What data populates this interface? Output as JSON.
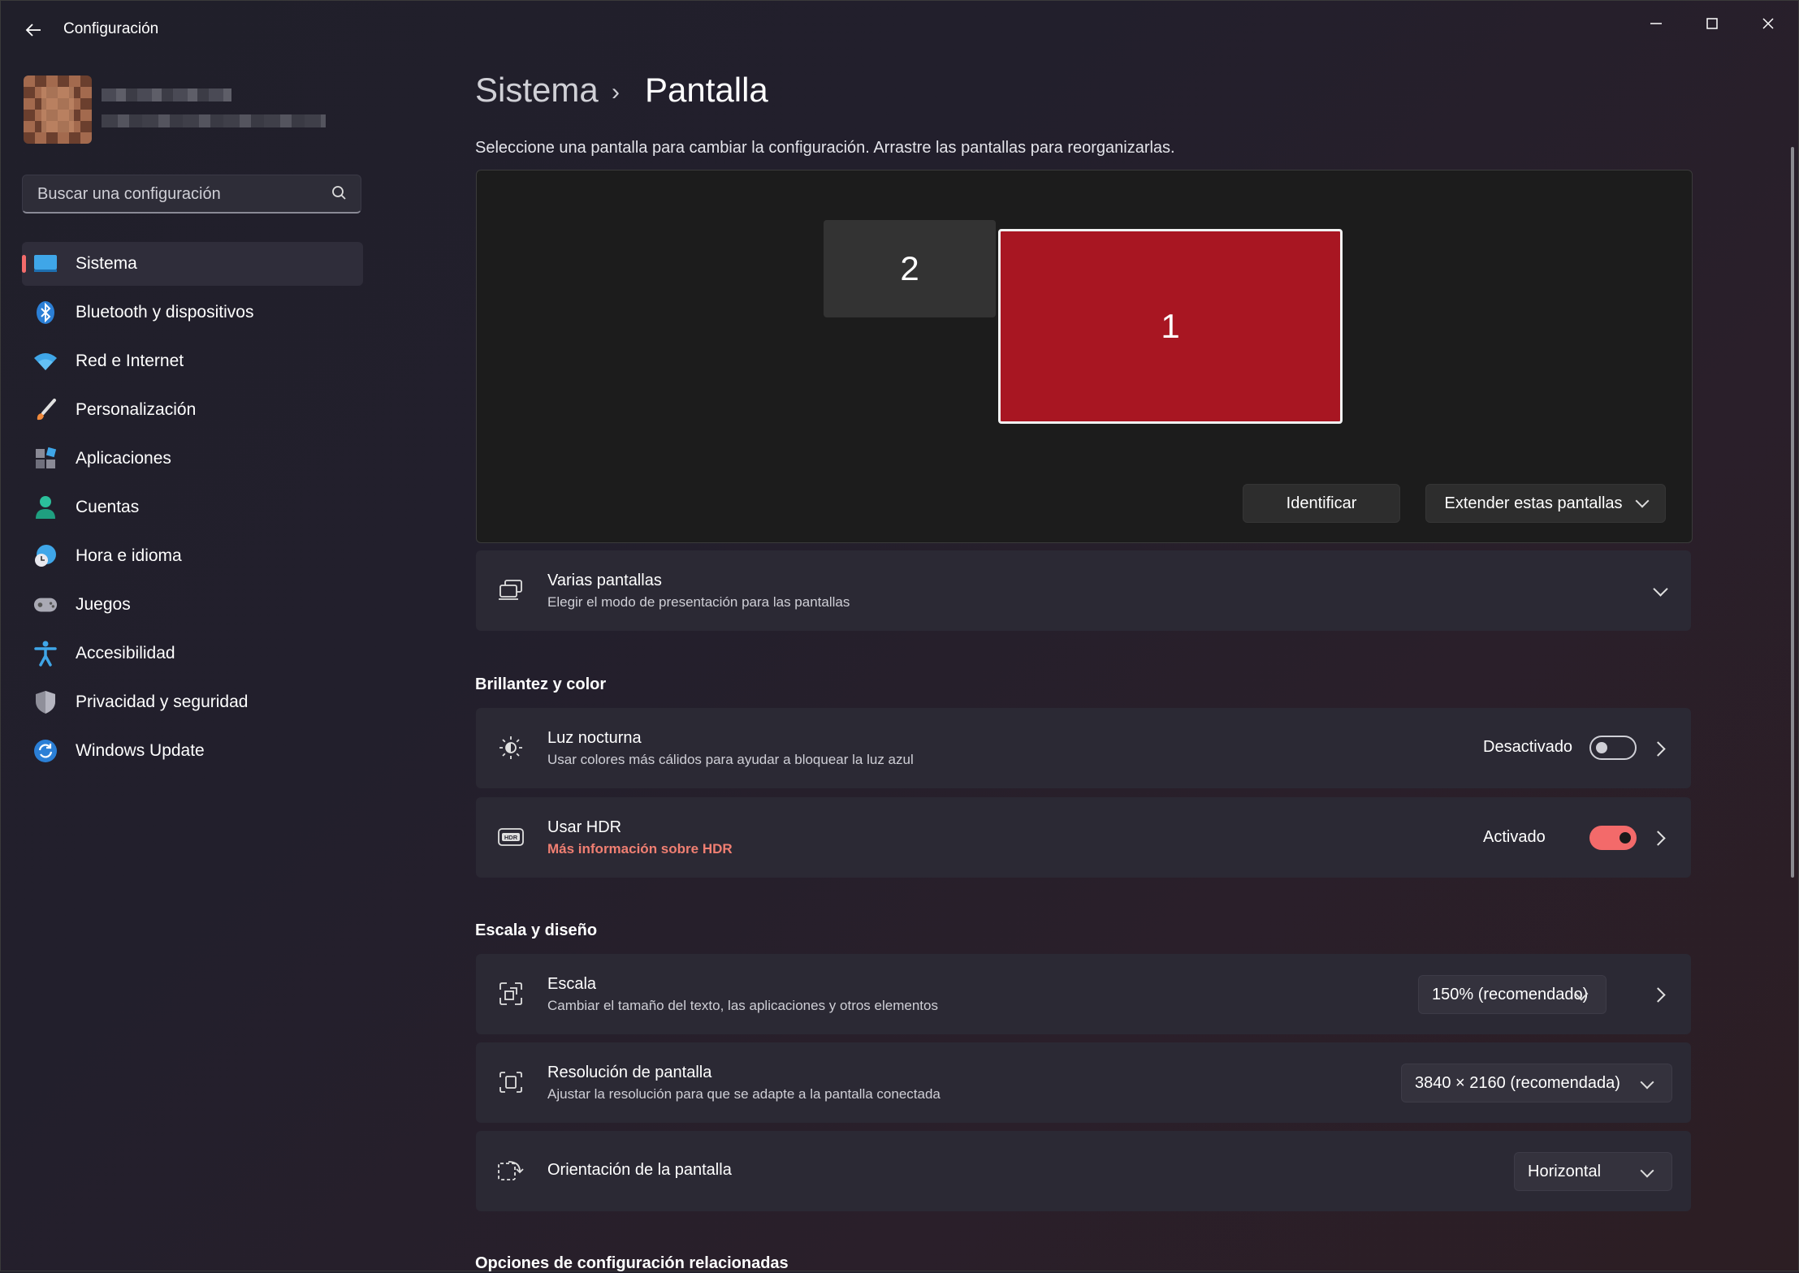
{
  "window": {
    "title": "Configuración",
    "back_icon": "arrow-left-icon",
    "minimize_icon": "minimize-icon",
    "maximize_icon": "maximize-icon",
    "close_icon": "close-icon"
  },
  "search": {
    "placeholder": "Buscar una configuración",
    "value": ""
  },
  "sidebar": {
    "items": [
      {
        "label": "Sistema",
        "icon": "monitor-icon",
        "active": true
      },
      {
        "label": "Bluetooth y dispositivos",
        "icon": "bluetooth-icon"
      },
      {
        "label": "Red e Internet",
        "icon": "wifi-icon"
      },
      {
        "label": "Personalización",
        "icon": "brush-icon"
      },
      {
        "label": "Aplicaciones",
        "icon": "apps-icon"
      },
      {
        "label": "Cuentas",
        "icon": "person-icon"
      },
      {
        "label": "Hora e idioma",
        "icon": "globe-clock-icon"
      },
      {
        "label": "Juegos",
        "icon": "gamepad-icon"
      },
      {
        "label": "Accesibilidad",
        "icon": "accessibility-icon"
      },
      {
        "label": "Privacidad y seguridad",
        "icon": "shield-icon"
      },
      {
        "label": "Windows Update",
        "icon": "update-icon"
      }
    ]
  },
  "breadcrumb": {
    "parent": "Sistema",
    "separator": "›",
    "current": "Pantalla"
  },
  "display": {
    "description": "Seleccione una pantalla para cambiar la configuración. Arrastre las pantallas para reorganizarlas.",
    "monitor_1": "1",
    "monitor_2": "2",
    "identify_label": "Identificar",
    "mode_label": "Extender estas pantallas"
  },
  "multi_display": {
    "title": "Varias pantallas",
    "subtitle": "Elegir el modo de presentación para las pantallas"
  },
  "brightness_section": {
    "heading": "Brillantez y color",
    "night_light": {
      "title": "Luz nocturna",
      "subtitle": "Usar colores más cálidos para ayudar a bloquear la luz azul",
      "state": "Desactivado",
      "on": false
    },
    "hdr": {
      "title": "Usar HDR",
      "link": "Más información sobre HDR",
      "state": "Activado",
      "on": true
    }
  },
  "scale_section": {
    "heading": "Escala y diseño",
    "scale": {
      "title": "Escala",
      "subtitle": "Cambiar el tamaño del texto, las aplicaciones y otros elementos",
      "value": "150% (recomendado)"
    },
    "resolution": {
      "title": "Resolución de pantalla",
      "subtitle": "Ajustar la resolución para que se adapte a la pantalla conectada",
      "value": "3840 × 2160 (recomendada)"
    },
    "orientation": {
      "title": "Orientación de la pantalla",
      "value": "Horizontal"
    }
  },
  "related": {
    "heading": "Opciones de configuración relacionadas"
  },
  "colors": {
    "accent": "#f36b6b",
    "monitor_selected": "#a81622",
    "link": "#f07f72"
  }
}
